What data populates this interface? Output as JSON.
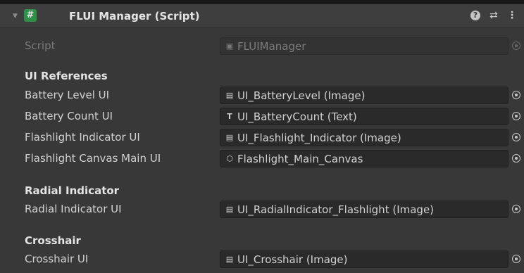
{
  "component": {
    "title": "FLUI Manager (Script)",
    "enabled_icon": "#",
    "help_icon": "?",
    "presets_icon": "⇄",
    "menu_icon": "⋮"
  },
  "script_row": {
    "label": "Script",
    "value": "FLUIManager"
  },
  "sections": [
    {
      "header": "UI References",
      "fields": [
        {
          "label": "Battery Level UI",
          "value": "UI_BatteryLevel (Image)",
          "icon": "image-icon"
        },
        {
          "label": "Battery Count UI",
          "value": "UI_BatteryCount (Text)",
          "icon": "text-icon"
        },
        {
          "label": "Flashlight Indicator UI",
          "value": "UI_Flashlight_Indicator (Image)",
          "icon": "image-icon"
        },
        {
          "label": "Flashlight Canvas Main UI",
          "value": "Flashlight_Main_Canvas",
          "icon": "gameobject-icon"
        }
      ]
    },
    {
      "header": "Radial Indicator",
      "fields": [
        {
          "label": "Radial Indicator UI",
          "value": "UI_RadialIndicator_Flashlight (Image)",
          "icon": "image-icon"
        }
      ]
    },
    {
      "header": "Crosshair",
      "fields": [
        {
          "label": "Crosshair UI",
          "value": "UI_Crosshair (Image)",
          "icon": "image-icon"
        }
      ]
    }
  ]
}
